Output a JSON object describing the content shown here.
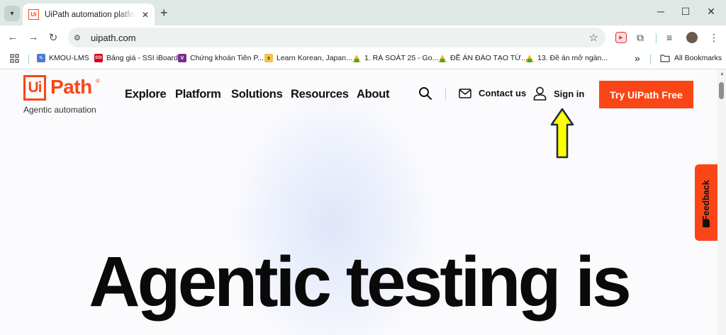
{
  "browser": {
    "tab": {
      "favicon": "Ui",
      "title": "UiPath automation platform: drive",
      "close": "✕"
    },
    "new_tab": "+",
    "window_controls": {
      "minimize": "─",
      "maximize": "☐",
      "close": "✕"
    },
    "nav": {
      "back": "←",
      "forward": "→",
      "reload": "↻"
    },
    "url": "uipath.com",
    "bookmarks": [
      {
        "label": "KMOU-LMS",
        "icon": "doc-icon",
        "color": "#4a7bd0"
      },
      {
        "label": "Bảng giá - SSI iBoard",
        "icon": "SSI",
        "color": "#d0021b"
      },
      {
        "label": "Chứng khoán Tiên P...",
        "icon": "V",
        "color": "#7b2d8b"
      },
      {
        "label": "Learn Korean, Japan...",
        "icon": "cat-icon",
        "color": "#d9a000"
      },
      {
        "label": "1. RÀ SOÁT 25 - Go...",
        "icon": "drive-icon",
        "color": "#fbbc04"
      },
      {
        "label": "ĐỀ ÁN ĐÀO TẠO TỪ...",
        "icon": "drive-icon",
        "color": "#fbbc04"
      },
      {
        "label": "13. Đề án mở ngàn...",
        "icon": "drive-icon",
        "color": "#fbbc04"
      }
    ],
    "bookmarks_more": "»",
    "all_bookmarks": "All Bookmarks"
  },
  "site": {
    "logo_ui": "Ui",
    "logo_path": "Path",
    "logo_reg": "®",
    "tagline": "Agentic automation",
    "nav": [
      "Explore",
      "Platform",
      "Solutions",
      "Resources",
      "About"
    ],
    "contact": "Contact us",
    "sign_in": "Sign in",
    "cta": "Try UiPath Free",
    "feedback": "Feedback",
    "hero": "Agentic testing is",
    "brand_color": "#fa4616",
    "arrow_color": "#ffff00"
  }
}
